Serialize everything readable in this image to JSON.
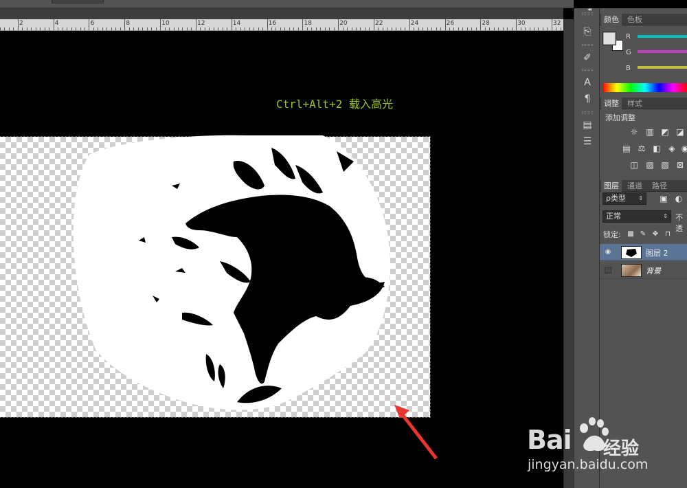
{
  "ruler": {
    "labels": [
      "2",
      "4",
      "6",
      "8",
      "10",
      "12",
      "14",
      "16",
      "18",
      "20",
      "22",
      "24",
      "26",
      "28",
      "30",
      "32"
    ]
  },
  "canvas": {
    "annotation": "Ctrl+Alt+2 载入高光",
    "arrow_color": "#e8362f",
    "text_color": "#9ec31b"
  },
  "panels": {
    "color_tabs": [
      "颜色",
      "色板"
    ],
    "channels": [
      {
        "label": "R",
        "color": "#00c0c0"
      },
      {
        "label": "G",
        "color": "#c040c0"
      },
      {
        "label": "B",
        "color": "#c0c040"
      }
    ],
    "adjust_tabs": [
      "调整",
      "样式"
    ],
    "adjust_title": "添加调整",
    "layer_tabs": [
      "图层",
      "通道",
      "路径"
    ],
    "filter_kind": "ρ类型",
    "blend_mode": "正常",
    "opacity_label": "不透",
    "lock_label": "锁定:",
    "layers": [
      {
        "name": "图层 2",
        "selected": true,
        "visible": true
      },
      {
        "name": "背景",
        "selected": false,
        "visible": false
      }
    ]
  },
  "tools": {
    "icons": [
      "history-icon",
      "brush-preset-icon",
      "character-icon",
      "paragraph-icon",
      "layer-comps-icon",
      "notes-icon"
    ]
  },
  "watermark": {
    "brand": "Bai",
    "brand2": "经验",
    "url": "jingyan.baidu.com"
  }
}
